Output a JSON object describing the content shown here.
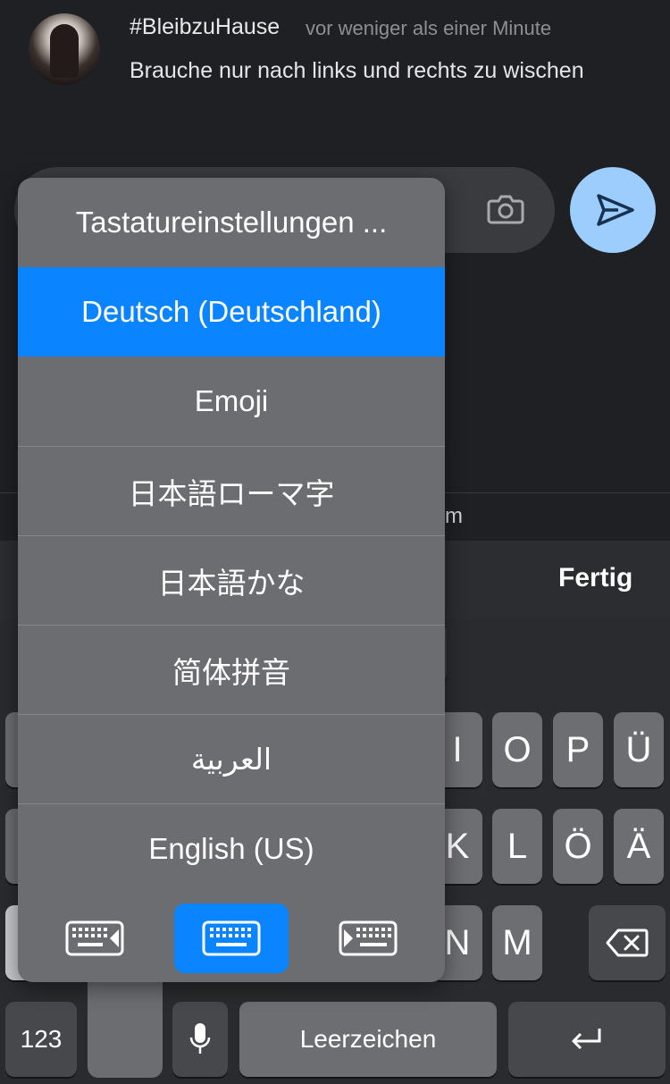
{
  "post": {
    "username": "#BleibzuHause",
    "timestamp": "vor weniger als einer Minute",
    "message": "Brauche nur nach links und rechts zu wischen"
  },
  "behind_text": "m",
  "toolbar": {
    "done_label": "Fertig"
  },
  "keyboard": {
    "row1_visible": [
      "I",
      "O",
      "P",
      "Ü"
    ],
    "row2_visible": [
      "K",
      "L",
      "Ö",
      "Ä"
    ],
    "row3_visible": [
      "N",
      "M"
    ],
    "numbers_label": "123",
    "space_label": "Leerzeichen"
  },
  "language_menu": {
    "items": [
      "Tastatureinstellungen ...",
      "Deutsch (Deutschland)",
      "Emoji",
      "日本語ローマ字",
      "日本語かな",
      "简体拼音",
      "العربية",
      "English (US)"
    ],
    "selected": "Deutsch (Deutschland)",
    "keyboard_modes": [
      "keyboard-left-icon",
      "keyboard-full-icon",
      "keyboard-right-icon"
    ],
    "active_mode": "keyboard-full-icon"
  },
  "colors": {
    "accent": "#0a84ff",
    "send_button": "#9ccdfd",
    "background": "#1f2023"
  }
}
